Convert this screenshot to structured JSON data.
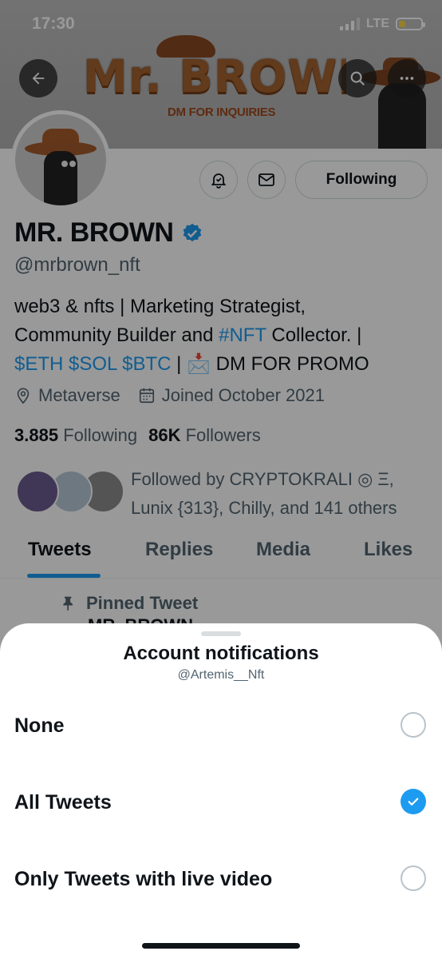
{
  "status_bar": {
    "time": "17:30",
    "network": "LTE"
  },
  "banner": {
    "title": "Mr. BROWN",
    "subtitle": "DM FOR INQUIRIES"
  },
  "profile": {
    "name": "MR. BROWN",
    "handle": "@mrbrown_nft",
    "bio": {
      "line1": "web3 & nfts | Marketing Strategist,",
      "line2_a": "Community Builder and ",
      "line2_link": "#NFT",
      "line2_b": " Collector. |",
      "line3_link": "$ETH $SOL $BTC",
      "line3_b": " | 📩 DM FOR PROMO"
    },
    "location": "Metaverse",
    "joined": "Joined October 2021",
    "following_count": "3.885",
    "following_label": "Following",
    "followers_count": "86K",
    "followers_label": "Followers",
    "followed_by": "Followed by CRYPTOKRALI ◎ Ξ, Lunix {313}, Chilly, and 141 others",
    "following_button": "Following",
    "verified_color": "#1d9bf0"
  },
  "tabs": [
    {
      "label": "Tweets",
      "active": true
    },
    {
      "label": "Replies",
      "active": false
    },
    {
      "label": "Media",
      "active": false
    },
    {
      "label": "Likes",
      "active": false
    }
  ],
  "pinned": {
    "label": "Pinned Tweet",
    "author": "MR. BROWN"
  },
  "sheet": {
    "title": "Account notifications",
    "subtitle": "@Artemis__Nft",
    "options": [
      {
        "label": "None",
        "selected": false
      },
      {
        "label": "All Tweets",
        "selected": true
      },
      {
        "label": "Only Tweets with live video",
        "selected": false
      }
    ]
  },
  "colors": {
    "accent": "#1d9bf0",
    "text": "#0f1419",
    "secondary": "#536471"
  }
}
